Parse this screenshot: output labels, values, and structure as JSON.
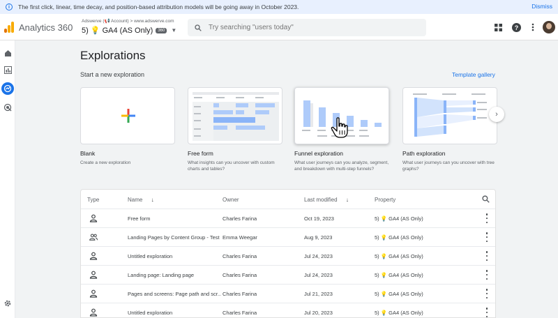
{
  "banner": {
    "text": "The first click, linear, time decay, and position-based attribution models will be going away in October 2023.",
    "dismiss": "Dismiss"
  },
  "header": {
    "app_title": "Analytics 360",
    "account_crumb": "Adswerve (📢 Account) > www.adswerve.com",
    "property": "5) 💡 GA4 (AS Only)",
    "property_badge": "360",
    "search_placeholder": "Try searching \"users today\""
  },
  "page": {
    "title": "Explorations",
    "section_label": "Start a new exploration",
    "template_gallery": "Template gallery"
  },
  "templates": [
    {
      "title": "Blank",
      "desc": "Create a new exploration"
    },
    {
      "title": "Free form",
      "desc": "What insights can you uncover with custom charts and tables?"
    },
    {
      "title": "Funnel exploration",
      "desc": "What user journeys can you analyze, segment, and breakdown with multi-step funnels?"
    },
    {
      "title": "Path exploration",
      "desc": "What user journeys can you uncover with tree graphs?"
    }
  ],
  "table": {
    "headers": {
      "type": "Type",
      "name": "Name",
      "owner": "Owner",
      "modified": "Last modified",
      "property": "Property"
    },
    "rows": [
      {
        "icon": "person-icon",
        "name": "Free form",
        "owner": "Charles Farina",
        "modified": "Oct 19, 2023",
        "property": "5) 💡 GA4 (AS Only)"
      },
      {
        "icon": "people-icon",
        "name": "Landing Pages by Content Group - Test",
        "owner": "Emma Weegar",
        "modified": "Aug 9, 2023",
        "property": "5) 💡 GA4 (AS Only)"
      },
      {
        "icon": "person-icon",
        "name": "Untitled exploration",
        "owner": "Charles Farina",
        "modified": "Jul 24, 2023",
        "property": "5) 💡 GA4 (AS Only)"
      },
      {
        "icon": "person-icon",
        "name": "Landing page: Landing page",
        "owner": "Charles Farina",
        "modified": "Jul 24, 2023",
        "property": "5) 💡 GA4 (AS Only)"
      },
      {
        "icon": "person-icon",
        "name": "Pages and screens: Page path and scr...",
        "owner": "Charles Farina",
        "modified": "Jul 21, 2023",
        "property": "5) 💡 GA4 (AS Only)"
      },
      {
        "icon": "person-icon",
        "name": "Untitled exploration",
        "owner": "Charles Farina",
        "modified": "Jul 20, 2023",
        "property": "5) 💡 GA4 (AS Only)"
      }
    ]
  },
  "colors": {
    "accent": "#1a73e8",
    "logo_orange": "#f9ab00",
    "logo_dark_orange": "#e37400",
    "plus_red": "#ea4335",
    "plus_yellow": "#fbbc04",
    "plus_green": "#34a853",
    "plus_blue": "#4285f4",
    "preview_blue": "#aecbfa"
  }
}
